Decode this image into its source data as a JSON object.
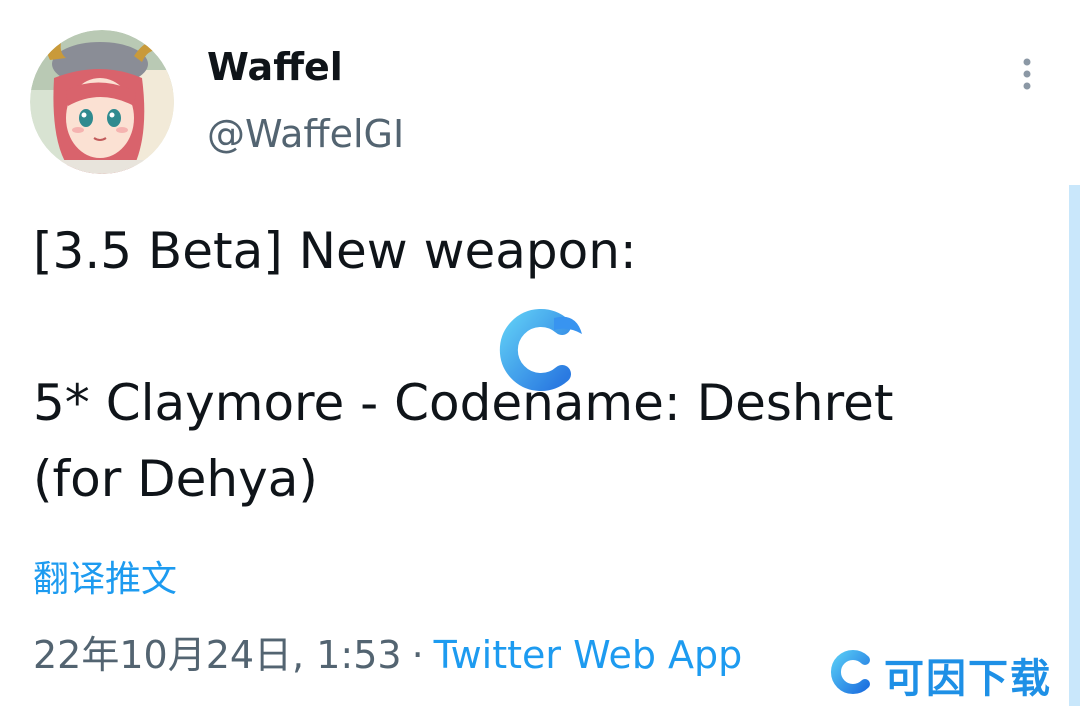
{
  "author": {
    "display_name": "Waffel",
    "handle": "@WaffelGI"
  },
  "tweet": {
    "lines": [
      "[3.5 Beta] New weapon:",
      "",
      "5* Claymore - Codename: Deshret",
      "(for Dehya)"
    ]
  },
  "translate_label": "翻译推文",
  "meta": {
    "timestamp": "22年10月24日, 1:53",
    "separator": "·",
    "source": "Twitter Web App"
  },
  "icons": {
    "more": "more-vertical-icon",
    "watermark_logo": "c-logo-icon"
  },
  "watermark": {
    "text": "可因下载"
  },
  "colors": {
    "link": "#1d9bf0",
    "text": "#0f1419",
    "secondary": "#536471",
    "brand": "#1e90e6"
  }
}
